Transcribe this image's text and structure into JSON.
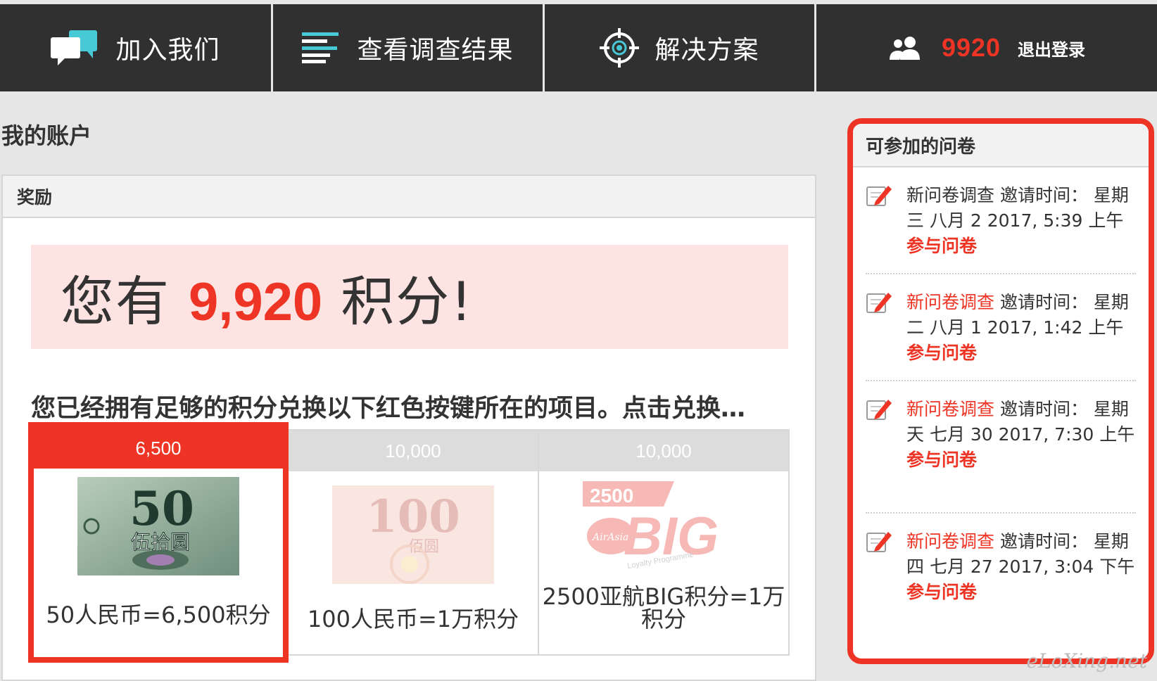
{
  "nav": {
    "join_label": "加入我们",
    "results_label": "查看调查结果",
    "solutions_label": "解决方案",
    "user_points": "9920",
    "logout_label": "退出登录"
  },
  "page": {
    "title": "我的账户"
  },
  "rewards": {
    "panel_title": "奖励",
    "banner_prefix": "您有",
    "banner_points": "9,920",
    "banner_suffix": "积分!",
    "note": "您已经拥有足够的积分兑换以下红色按键所在的项目。点击兑换…",
    "items": [
      {
        "price": "6,500",
        "caption": "50人民币=6,500积分",
        "image": "50-yuan-banknote",
        "available": true
      },
      {
        "price": "10,000",
        "caption": "100人民币=1万积分",
        "image": "100-yuan-banknote",
        "available": false
      },
      {
        "price": "10,000",
        "caption": "2500亚航BIG积分=1万积分",
        "image": "airasia-big-logo",
        "available": false
      }
    ],
    "big_logo": {
      "number": "2500",
      "word": "BIG",
      "brand": "AirAsia",
      "tagline": "Loyalty Programme"
    },
    "note_50": {
      "numeral": "50",
      "characters": "伍拾圆"
    },
    "note_100": {
      "numeral": "100",
      "characters": "佰圆"
    }
  },
  "surveys": {
    "panel_title": "可参加的问卷",
    "cta_label": "参与问卷",
    "items": [
      {
        "title": "新问卷调查",
        "detail": " 邀请时间： 星期三 八月 2 2017, 5:39 上午",
        "title_linked": false
      },
      {
        "title": "新问卷调查",
        "detail": " 邀请时间： 星期二 八月 1 2017, 1:42 上午",
        "title_linked": true
      },
      {
        "title": "新问卷调查",
        "detail": " 邀请时间： 星期天 七月 30 2017, 7:30 上午",
        "title_linked": true
      },
      {
        "title": "新问卷调查",
        "detail": " 邀请时间： 星期四 七月 27 2017, 3:04 下午",
        "title_linked": true
      }
    ]
  },
  "watermark": "eLoXing.net",
  "colors": {
    "accent": "#ee3424",
    "nav_bg": "#303030",
    "banner_bg": "#fde3e2",
    "teal_icon": "#48c9d6"
  }
}
